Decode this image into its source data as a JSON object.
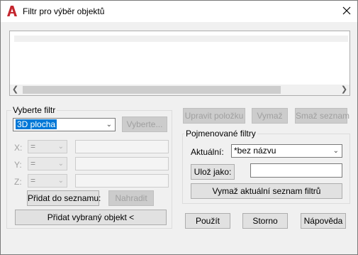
{
  "window": {
    "title": "Filtr pro výběr objektů"
  },
  "list": {},
  "filter_group": {
    "legend": "Vyberte filtr",
    "filter_combo_value": "3D plocha",
    "select_button": "Vyberte...",
    "x_label": "X:",
    "y_label": "Y:",
    "z_label": "Z:",
    "op_value": "=",
    "add_to_list_button": "Přidat do seznamu:",
    "replace_button": "Nahradit",
    "add_selected_button": "Přidat vybraný objekt <"
  },
  "top_buttons": {
    "edit_item": "Upravit položku",
    "delete": "Vymaž",
    "clear_list": "Smaž seznam"
  },
  "named_filters": {
    "legend": "Pojmenované filtry",
    "current_label": "Aktuální:",
    "current_value": "*bez názvu",
    "save_as_button": "Ulož jako:",
    "save_as_value": "",
    "delete_current_button": "Vymaž aktuální seznam filtrů"
  },
  "bottom_buttons": {
    "apply": "Použít",
    "cancel": "Storno",
    "help": "Nápověda"
  },
  "colors": {
    "accent_red": "#c4262e",
    "disabled_text": "#a0a0a0"
  }
}
